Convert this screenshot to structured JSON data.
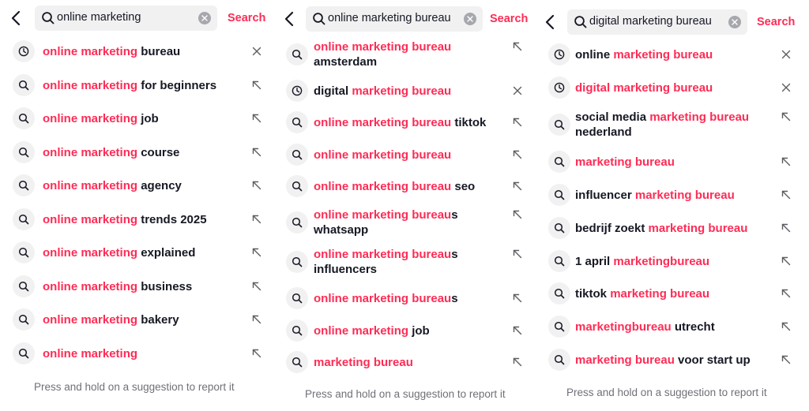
{
  "panels": [
    {
      "query": "online marketing",
      "search_label": "Search",
      "footer": "Press and hold on a suggestion to report it",
      "items": [
        {
          "icon": "history-icon",
          "action": "remove-icon",
          "parts": [
            {
              "t": "online marketing",
              "h": true
            },
            {
              "t": " bureau",
              "h": false
            }
          ]
        },
        {
          "icon": "search-icon",
          "action": "fill-arrow-icon",
          "parts": [
            {
              "t": "online marketing",
              "h": true
            },
            {
              "t": " for beginners",
              "h": false
            }
          ]
        },
        {
          "icon": "search-icon",
          "action": "fill-arrow-icon",
          "parts": [
            {
              "t": "online marketing",
              "h": true
            },
            {
              "t": " job",
              "h": false
            }
          ]
        },
        {
          "icon": "search-icon",
          "action": "fill-arrow-icon",
          "parts": [
            {
              "t": "online marketing",
              "h": true
            },
            {
              "t": " course",
              "h": false
            }
          ]
        },
        {
          "icon": "search-icon",
          "action": "fill-arrow-icon",
          "parts": [
            {
              "t": "online marketing",
              "h": true
            },
            {
              "t": " agency",
              "h": false
            }
          ]
        },
        {
          "icon": "search-icon",
          "action": "fill-arrow-icon",
          "parts": [
            {
              "t": "online marketing",
              "h": true
            },
            {
              "t": " trends 2025",
              "h": false
            }
          ]
        },
        {
          "icon": "search-icon",
          "action": "fill-arrow-icon",
          "parts": [
            {
              "t": "online marketing",
              "h": true
            },
            {
              "t": " explained",
              "h": false
            }
          ]
        },
        {
          "icon": "search-icon",
          "action": "fill-arrow-icon",
          "parts": [
            {
              "t": "online marketing",
              "h": true
            },
            {
              "t": " business",
              "h": false
            }
          ]
        },
        {
          "icon": "search-icon",
          "action": "fill-arrow-icon",
          "parts": [
            {
              "t": "online marketing",
              "h": true
            },
            {
              "t": " bakery",
              "h": false
            }
          ]
        },
        {
          "icon": "search-icon",
          "action": "fill-arrow-icon",
          "parts": [
            {
              "t": "online marketing",
              "h": true
            }
          ]
        }
      ]
    },
    {
      "query": "online marketing bureau",
      "search_label": "Search",
      "footer": "Press and hold on a suggestion to report it",
      "items": [
        {
          "icon": "search-icon",
          "action": "fill-arrow-icon",
          "parts": [
            {
              "t": "online marketing bureau",
              "h": true
            },
            {
              "t": " amsterdam",
              "h": false
            }
          ]
        },
        {
          "icon": "history-icon",
          "action": "remove-icon",
          "parts": [
            {
              "t": "digital ",
              "h": false
            },
            {
              "t": "marketing bureau",
              "h": true
            }
          ]
        },
        {
          "icon": "search-icon",
          "action": "fill-arrow-icon",
          "parts": [
            {
              "t": "online marketing bureau",
              "h": true
            },
            {
              "t": " tiktok",
              "h": false
            }
          ]
        },
        {
          "icon": "search-icon",
          "action": "fill-arrow-icon",
          "parts": [
            {
              "t": "online marketing bureau",
              "h": true
            }
          ]
        },
        {
          "icon": "search-icon",
          "action": "fill-arrow-icon",
          "parts": [
            {
              "t": "online marketing bureau",
              "h": true
            },
            {
              "t": " seo",
              "h": false
            }
          ]
        },
        {
          "icon": "search-icon",
          "action": "fill-arrow-icon",
          "parts": [
            {
              "t": "online marketing bureau",
              "h": true
            },
            {
              "t": "s whatsapp",
              "h": false
            }
          ]
        },
        {
          "icon": "search-icon",
          "action": "fill-arrow-icon",
          "parts": [
            {
              "t": "online marketing bureau",
              "h": true
            },
            {
              "t": "s influencers",
              "h": false
            }
          ]
        },
        {
          "icon": "search-icon",
          "action": "fill-arrow-icon",
          "parts": [
            {
              "t": "online marketing bureau",
              "h": true
            },
            {
              "t": "s",
              "h": false
            }
          ]
        },
        {
          "icon": "search-icon",
          "action": "fill-arrow-icon",
          "parts": [
            {
              "t": "online marketing",
              "h": true
            },
            {
              "t": " job",
              "h": false
            }
          ]
        },
        {
          "icon": "search-icon",
          "action": "fill-arrow-icon",
          "parts": [
            {
              "t": "marketing bureau",
              "h": true
            }
          ]
        }
      ]
    },
    {
      "query": "digital marketing bureau",
      "search_label": "Search",
      "footer": "Press and hold on a suggestion to report it",
      "items": [
        {
          "icon": "history-icon",
          "action": "remove-icon",
          "parts": [
            {
              "t": "online ",
              "h": false
            },
            {
              "t": "marketing bureau",
              "h": true
            }
          ]
        },
        {
          "icon": "history-icon",
          "action": "remove-icon",
          "parts": [
            {
              "t": "digital marketing bureau",
              "h": true
            }
          ]
        },
        {
          "icon": "search-icon",
          "action": "fill-arrow-icon",
          "parts": [
            {
              "t": "social media ",
              "h": false
            },
            {
              "t": "marketing bureau",
              "h": true
            },
            {
              "t": " nederland",
              "h": false
            }
          ]
        },
        {
          "icon": "search-icon",
          "action": "fill-arrow-icon",
          "parts": [
            {
              "t": "marketing bureau",
              "h": true
            }
          ]
        },
        {
          "icon": "search-icon",
          "action": "fill-arrow-icon",
          "parts": [
            {
              "t": "influencer ",
              "h": false
            },
            {
              "t": "marketing bureau",
              "h": true
            }
          ]
        },
        {
          "icon": "search-icon",
          "action": "fill-arrow-icon",
          "parts": [
            {
              "t": "bedrijf zoekt ",
              "h": false
            },
            {
              "t": "marketing bureau",
              "h": true
            }
          ]
        },
        {
          "icon": "search-icon",
          "action": "fill-arrow-icon",
          "parts": [
            {
              "t": "1 april ",
              "h": false
            },
            {
              "t": "marketingbureau",
              "h": true
            }
          ]
        },
        {
          "icon": "search-icon",
          "action": "fill-arrow-icon",
          "parts": [
            {
              "t": "tiktok ",
              "h": false
            },
            {
              "t": "marketing bureau",
              "h": true
            }
          ]
        },
        {
          "icon": "search-icon",
          "action": "fill-arrow-icon",
          "parts": [
            {
              "t": "marketingbureau",
              "h": true
            },
            {
              "t": " utrecht",
              "h": false
            }
          ]
        },
        {
          "icon": "search-icon",
          "action": "fill-arrow-icon",
          "parts": [
            {
              "t": "marketing bureau",
              "h": true
            },
            {
              "t": " voor start up",
              "h": false
            }
          ]
        }
      ]
    }
  ],
  "colors": {
    "highlight": "#fe2c55",
    "text": "#161823",
    "muted": "#6f7078",
    "field": "#f1f1f2"
  }
}
